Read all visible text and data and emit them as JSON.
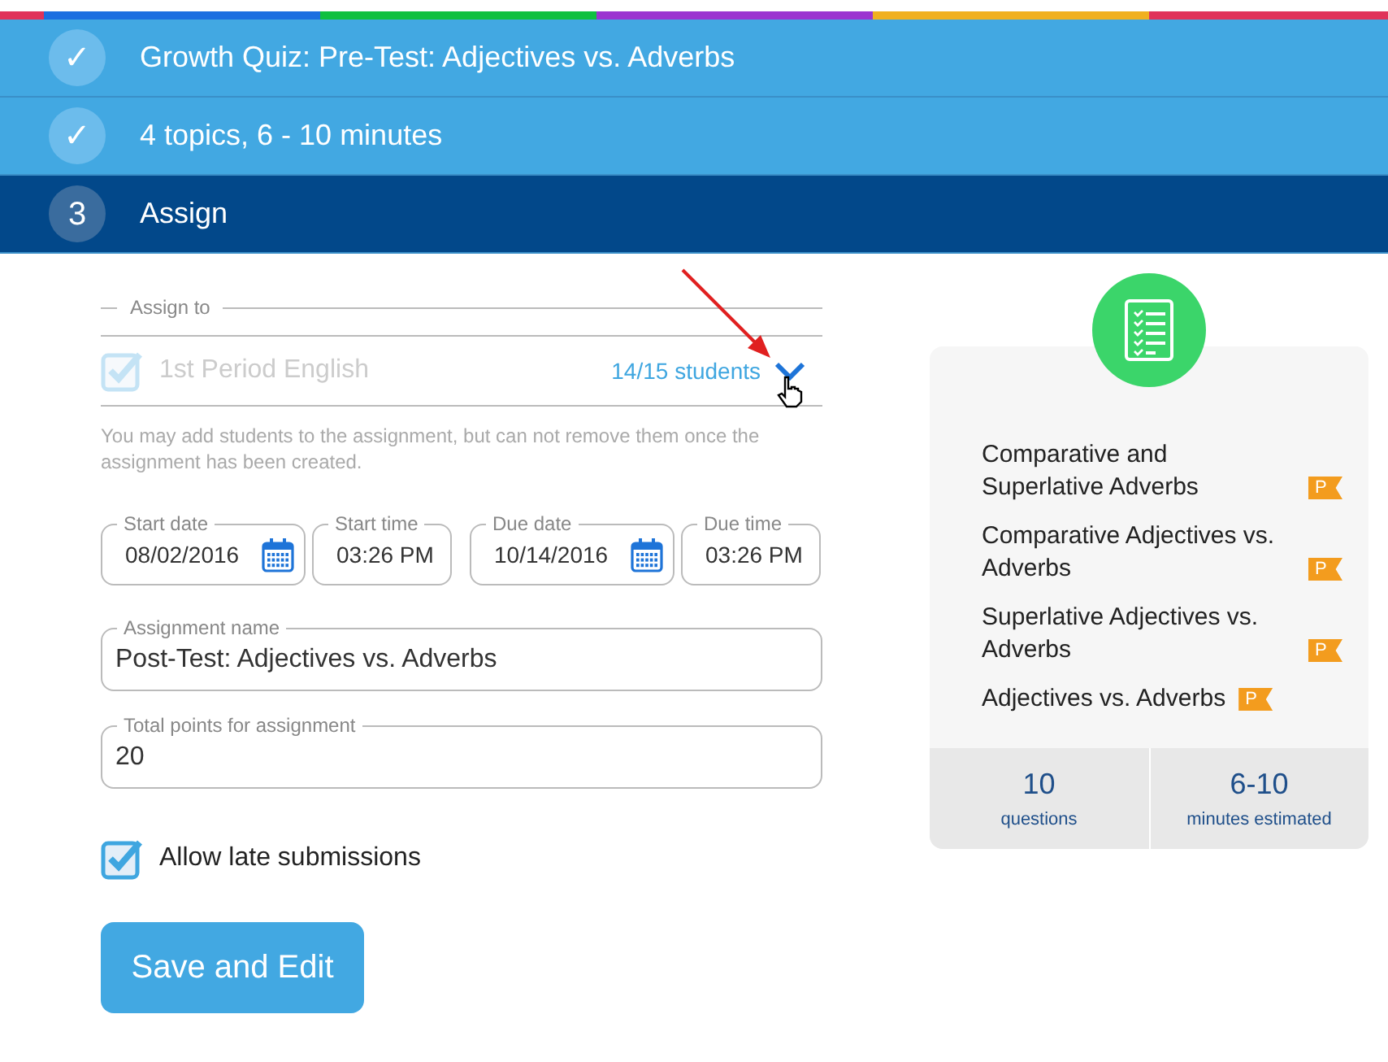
{
  "steps": [
    {
      "marker": "✓",
      "label": "Growth Quiz: Pre-Test: Adjectives vs. Adverbs",
      "kind": "done"
    },
    {
      "marker": "✓",
      "label": "4 topics, 6 - 10 minutes",
      "kind": "done"
    },
    {
      "marker": "3",
      "label": "Assign",
      "kind": "current"
    }
  ],
  "assign_to": {
    "legend": "Assign to",
    "group": {
      "name": "1st Period English",
      "checked": true,
      "disabled": true
    },
    "students": "14/15 students",
    "hint": "You may add students to the assignment, but can not remove them once the assignment has been created."
  },
  "dates": [
    {
      "label": "Start date",
      "value": "08/02/2016",
      "kind": "date"
    },
    {
      "label": "Start time",
      "value": "03:26 PM",
      "kind": "time"
    },
    {
      "label": "Due date",
      "value": "10/14/2016",
      "kind": "date"
    },
    {
      "label": "Due time",
      "value": "03:26 PM",
      "kind": "time"
    }
  ],
  "fields": [
    {
      "label": "Assignment name",
      "value": "Post-Test: Adjectives vs. Adverbs"
    },
    {
      "label": "Total points for assignment",
      "value": "20"
    }
  ],
  "late": {
    "label": "Allow late submissions",
    "checked": true
  },
  "save_button": "Save and Edit",
  "topics": [
    {
      "name": "Comparative and Superlative Adverbs",
      "flag": "P"
    },
    {
      "name": "Comparative Adjectives vs. Adverbs",
      "flag": "P"
    },
    {
      "name": "Superlative Adjectives vs. Adverbs",
      "flag": "P"
    },
    {
      "name": "Adjectives vs. Adverbs",
      "flag": "P"
    }
  ],
  "stats": [
    {
      "value": "10",
      "label": "questions"
    },
    {
      "value": "6-10",
      "label": "minutes estimated"
    }
  ]
}
